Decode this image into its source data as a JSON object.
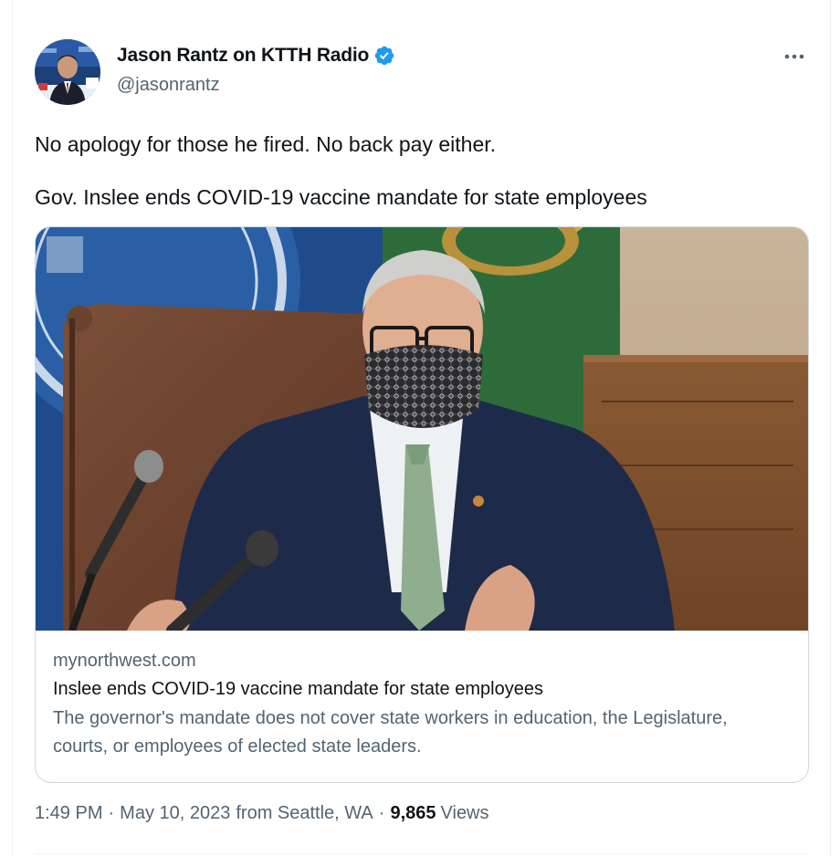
{
  "author": {
    "display_name": "Jason Rantz on KTTH Radio",
    "handle": "@jasonrantz",
    "verified_icon": "verified-badge-icon",
    "avatar_icon": "avatar"
  },
  "tweet": {
    "lines": [
      "No apology for those he fired. No back pay either.",
      "Gov. Inslee ends COVID-19 vaccine mandate for state employees"
    ]
  },
  "card": {
    "domain": "mynorthwest.com",
    "title": "Inslee ends COVID-19 vaccine mandate for state employees",
    "description": "The governor's mandate does not cover state workers in education, the Legislature, courts, or employees of elected state leaders."
  },
  "meta": {
    "time": "1:49 PM",
    "separator": "·",
    "date": "May 10, 2023",
    "location": "from Seattle, WA",
    "views_count": "9,865",
    "views_label": "Views"
  },
  "colors": {
    "text_primary": "#0f1419",
    "text_secondary": "#536471",
    "border": "#cfd9de",
    "verified_blue": "#1d9bf0"
  }
}
